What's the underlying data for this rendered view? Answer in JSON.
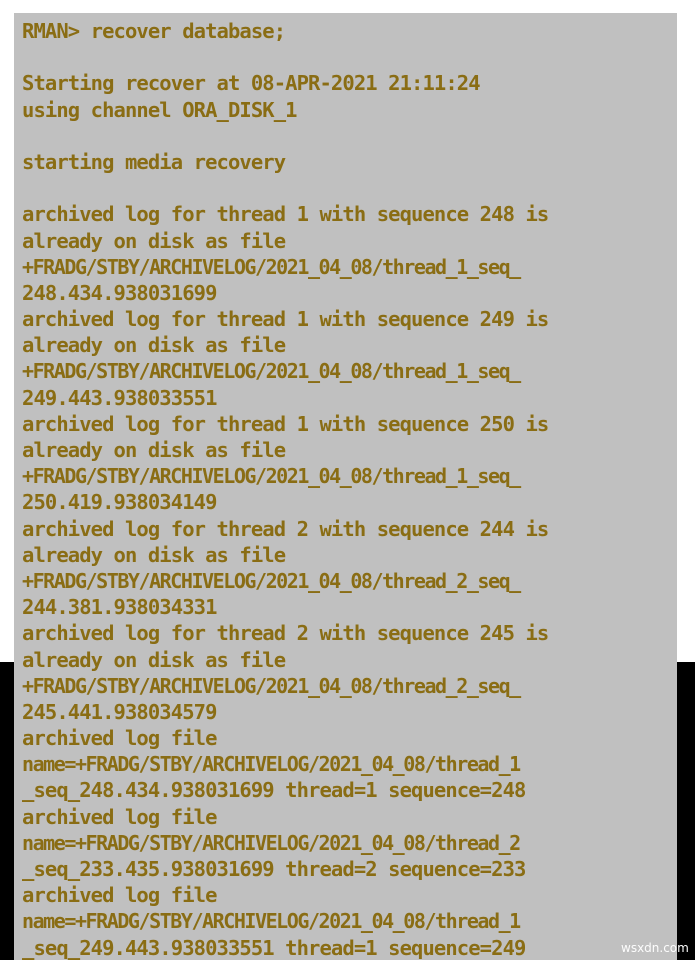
{
  "terminal": {
    "prompt": "RMAN>",
    "command": "recover database;",
    "text_color": "#8a6d14",
    "background_color": "#c0c0c0",
    "margin_top_color": "#ffffff",
    "margin_bottom_color": "#000000",
    "lines": [
      {
        "id": "line-1",
        "text": "RMAN> recover database;",
        "style": "cmd"
      },
      {
        "id": "line-2",
        "text": "",
        "style": "blank"
      },
      {
        "id": "line-3",
        "text": "Starting recover at 08-APR-2021 21:11:24",
        "style": "out"
      },
      {
        "id": "line-4",
        "text": "using channel ORA_DISK_1",
        "style": "out"
      },
      {
        "id": "line-5",
        "text": "",
        "style": "blank"
      },
      {
        "id": "line-6",
        "text": "starting media recovery",
        "style": "out"
      },
      {
        "id": "line-7",
        "text": "",
        "style": "blank"
      },
      {
        "id": "line-8",
        "text": "archived log for thread 1 with sequence 248 is",
        "style": "out"
      },
      {
        "id": "line-9",
        "text": "already on disk as file",
        "style": "out"
      },
      {
        "id": "line-10",
        "text": "+FRADG/STBY/ARCHIVELOG/2021_04_08/thread_1_seq_",
        "style": "path"
      },
      {
        "id": "line-11",
        "text": "248.434.938031699",
        "style": "out"
      },
      {
        "id": "line-12",
        "text": "archived log for thread 1 with sequence 249 is",
        "style": "out"
      },
      {
        "id": "line-13",
        "text": "already on disk as file",
        "style": "out"
      },
      {
        "id": "line-14",
        "text": "+FRADG/STBY/ARCHIVELOG/2021_04_08/thread_1_seq_",
        "style": "path"
      },
      {
        "id": "line-15",
        "text": "249.443.938033551",
        "style": "out"
      },
      {
        "id": "line-16",
        "text": "archived log for thread 1 with sequence 250 is",
        "style": "out"
      },
      {
        "id": "line-17",
        "text": "already on disk as file",
        "style": "out"
      },
      {
        "id": "line-18",
        "text": "+FRADG/STBY/ARCHIVELOG/2021_04_08/thread_1_seq_",
        "style": "path"
      },
      {
        "id": "line-19",
        "text": "250.419.938034149",
        "style": "out"
      },
      {
        "id": "line-20",
        "text": "archived log for thread 2 with sequence 244 is",
        "style": "out"
      },
      {
        "id": "line-21",
        "text": "already on disk as file",
        "style": "out"
      },
      {
        "id": "line-22",
        "text": "+FRADG/STBY/ARCHIVELOG/2021_04_08/thread_2_seq_",
        "style": "path"
      },
      {
        "id": "line-23",
        "text": "244.381.938034331",
        "style": "out"
      },
      {
        "id": "line-24",
        "text": "archived log for thread 2 with sequence 245 is",
        "style": "out"
      },
      {
        "id": "line-25",
        "text": "already on disk as file",
        "style": "out"
      },
      {
        "id": "line-26",
        "text": "+FRADG/STBY/ARCHIVELOG/2021_04_08/thread_2_seq_",
        "style": "path"
      },
      {
        "id": "line-27",
        "text": "245.441.938034579",
        "style": "out"
      },
      {
        "id": "line-28",
        "text": "archived log file",
        "style": "out"
      },
      {
        "id": "line-29",
        "text": "name=+FRADG/STBY/ARCHIVELOG/2021_04_08/thread_1",
        "style": "path"
      },
      {
        "id": "line-30",
        "text": "_seq_248.434.938031699 thread=1 sequence=248",
        "style": "out"
      },
      {
        "id": "line-31",
        "text": "archived log file",
        "style": "out"
      },
      {
        "id": "line-32",
        "text": "name=+FRADG/STBY/ARCHIVELOG/2021_04_08/thread_2",
        "style": "path"
      },
      {
        "id": "line-33",
        "text": "_seq_233.435.938031699 thread=2 sequence=233",
        "style": "out"
      },
      {
        "id": "line-34",
        "text": "archived log file",
        "style": "out"
      },
      {
        "id": "line-35",
        "text": "name=+FRADG/STBY/ARCHIVELOG/2021_04_08/thread_1",
        "style": "path"
      },
      {
        "id": "line-36",
        "text": "_seq_249.443.938033551 thread=1 sequence=249",
        "style": "out"
      }
    ]
  },
  "watermark": {
    "text": "wsxdn.com"
  }
}
